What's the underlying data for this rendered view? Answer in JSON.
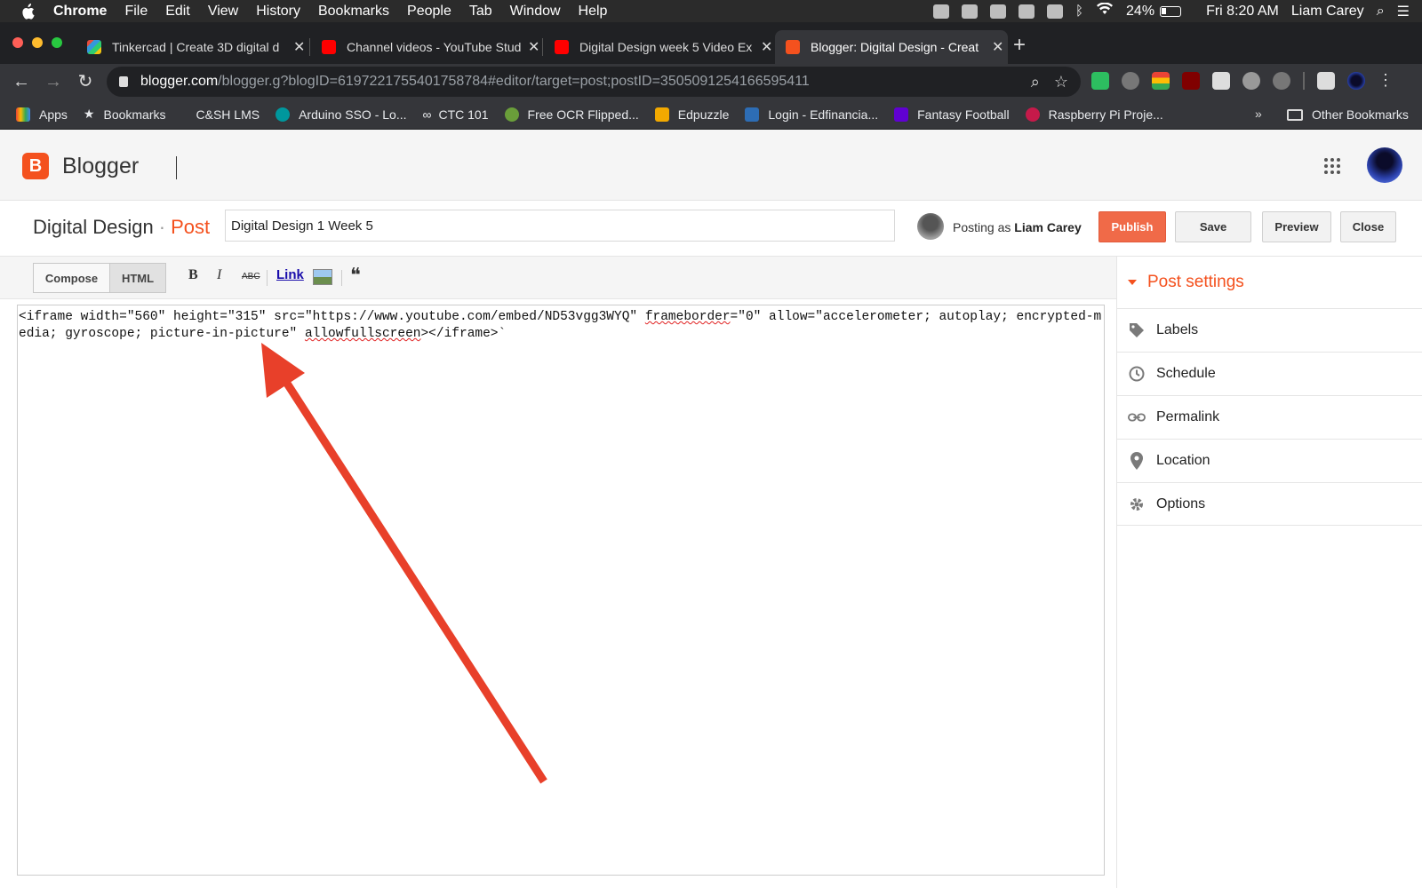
{
  "menubar": {
    "app": "Chrome",
    "items": [
      "File",
      "Edit",
      "View",
      "History",
      "Bookmarks",
      "People",
      "Tab",
      "Window",
      "Help"
    ],
    "battery": "24%",
    "clock": "Fri 8:20 AM",
    "user": "Liam Carey"
  },
  "tabs": [
    {
      "title": "Tinkercad | Create 3D digital d",
      "favicon_color": "#c0392b"
    },
    {
      "title": "Channel videos - YouTube Stud",
      "favicon_color": "#ff0000"
    },
    {
      "title": "Digital Design week 5 Video Ex",
      "favicon_color": "#ff0000"
    },
    {
      "title": "Blogger: Digital Design - Creat",
      "favicon_color": "#f4511e"
    }
  ],
  "address": {
    "host": "blogger.com",
    "path": "/blogger.g?blogID=6197221755401758784#editor/target=post;postID=3505091254166595411"
  },
  "bookmarks": [
    {
      "label": "Apps",
      "icon_color": "#4285f4"
    },
    {
      "label": "Bookmarks",
      "icon_color": "#dddddd"
    },
    {
      "label": "C&SH LMS",
      "icon_color": "#35363a"
    },
    {
      "label": "Arduino SSO - Lo...",
      "icon_color": "#00979d"
    },
    {
      "label": "CTC 101",
      "icon_color": "#cccccc"
    },
    {
      "label": "Free OCR Flipped...",
      "icon_color": "#6a9e3a"
    },
    {
      "label": "Edpuzzle",
      "icon_color": "#f2a900"
    },
    {
      "label": "Login - Edfinancia...",
      "icon_color": "#2d6db5"
    },
    {
      "label": "Fantasy Football",
      "icon_color": "#6001d2"
    },
    {
      "label": "Raspberry Pi Proje...",
      "icon_color": "#c51a4a"
    }
  ],
  "bookmarks_more": "»",
  "other_bookmarks": "Other Bookmarks",
  "blogger": {
    "brand": "Blogger",
    "blog_name": "Digital Design",
    "separator": "·",
    "section": "Post",
    "post_title_value": "Digital Design 1 Week 5",
    "posting_as_prefix": "Posting as",
    "posting_as_user": "Liam Carey",
    "buttons": {
      "publish": "Publish",
      "save": "Save",
      "preview": "Preview",
      "close": "Close"
    },
    "modes": {
      "compose": "Compose",
      "html": "HTML"
    },
    "format": {
      "bold": "B",
      "italic": "I",
      "strike": "ABC",
      "link": "Link",
      "quote": "❝"
    },
    "html_source": {
      "part1": "<iframe width=\"560\" height=\"315\" src=\"https://www.youtube.com/embed/ND53vgg3WYQ\" ",
      "frameborder": "frameborder",
      "part2": "=\"0\" allow=\"accelerometer; autoplay; encrypted-media; gyroscope; picture-in-picture\" ",
      "allowfullscreen": "allowfullscreen",
      "part3": "></iframe>`"
    },
    "sidebar": {
      "title": "Post settings",
      "items": [
        "Labels",
        "Schedule",
        "Permalink",
        "Location",
        "Options"
      ]
    }
  },
  "colors": {
    "accent": "#f4511e",
    "publish": "#f06a48",
    "annotation_arrow": "#e8402a"
  }
}
